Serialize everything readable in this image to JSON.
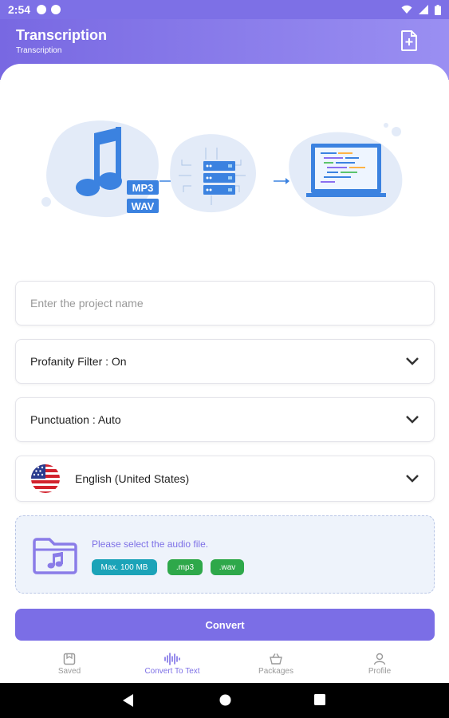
{
  "status": {
    "time": "2:54"
  },
  "appbar": {
    "title": "Transcription",
    "subtitle": "Transcription",
    "action_icon": "add-file-icon"
  },
  "hero": {
    "badge_mp3": "MP3",
    "badge_wav": "WAV"
  },
  "project": {
    "placeholder": "Enter the project name",
    "value": ""
  },
  "profanity": {
    "label": "Profanity Filter : On"
  },
  "punctuation": {
    "label": "Punctuation : Auto"
  },
  "language": {
    "label": "English (United States)",
    "flag_icon": "us-flag-icon"
  },
  "upload": {
    "prompt": "Please select the audio file.",
    "chips": [
      {
        "label": "Max. 100 MB",
        "color": "#1ba3b8"
      },
      {
        "label": ".mp3",
        "color": "#2ea84a"
      },
      {
        "label": ".wav",
        "color": "#2ea84a"
      }
    ]
  },
  "convert": {
    "label": "Convert"
  },
  "bottom_nav": [
    {
      "label": "Saved",
      "icon": "saved-icon",
      "active": false
    },
    {
      "label": "Convert To Text",
      "icon": "waveform-icon",
      "active": true
    },
    {
      "label": "Packages",
      "icon": "basket-icon",
      "active": false
    },
    {
      "label": "Profile",
      "icon": "person-icon",
      "active": false
    }
  ],
  "colors": {
    "accent": "#7d70e6",
    "chip_teal": "#1ba3b8",
    "chip_green": "#2ea84a"
  }
}
